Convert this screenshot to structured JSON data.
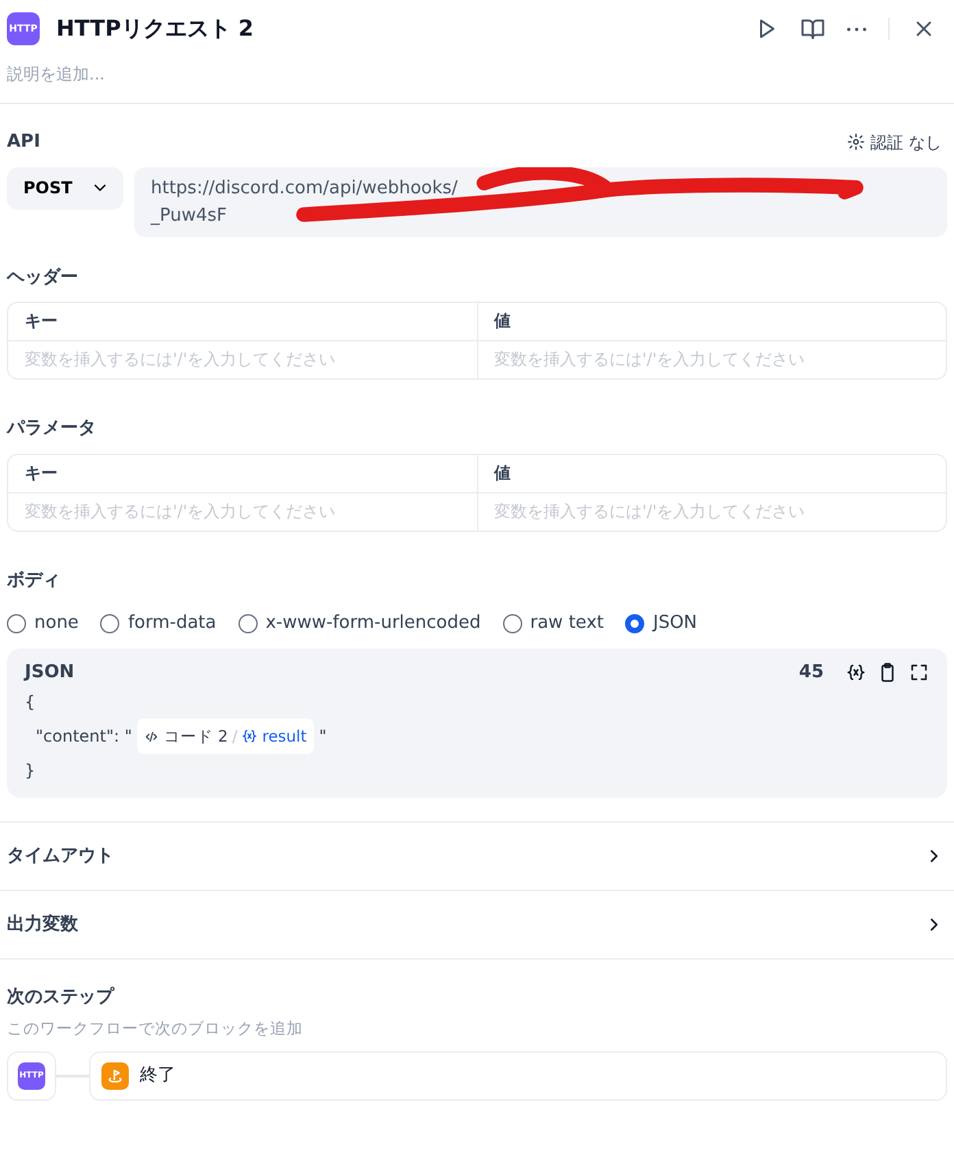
{
  "header": {
    "icon_text": "HTTP",
    "title": "HTTPリクエスト 2",
    "description_placeholder": "説明を追加..."
  },
  "api": {
    "label": "API",
    "auth": "認証 なし",
    "method": "POST",
    "url_lines": [
      "https://discord.com/api/webhooks/",
      "_Puw4sF"
    ]
  },
  "tables": [
    {
      "label": "ヘッダー",
      "columns": [
        "キー",
        "値"
      ],
      "placeholders": [
        "変数を挿入するには'/'を入力してください",
        "変数を挿入するには'/'を入力してください"
      ]
    },
    {
      "label": "パラメータ",
      "columns": [
        "キー",
        "値"
      ],
      "placeholders": [
        "変数を挿入するには'/'を入力してください",
        "変数を挿入するには'/'を入力してください"
      ]
    }
  ],
  "body": {
    "label": "ボディ",
    "options": [
      {
        "label": "none",
        "selected": false
      },
      {
        "label": "form-data",
        "selected": false
      },
      {
        "label": "x-www-form-urlencoded",
        "selected": false
      },
      {
        "label": "raw text",
        "selected": false
      },
      {
        "label": "JSON",
        "selected": true
      }
    ],
    "editor": {
      "label": "JSON",
      "count": "45",
      "open": "{",
      "key": "\"content\": \"",
      "node": "コード 2",
      "sep": "/",
      "variable": "result",
      "quote": "\"",
      "close": "}"
    }
  },
  "sections": [
    {
      "label": "タイムアウト"
    },
    {
      "label": "出力変数"
    }
  ],
  "next_step": {
    "title": "次のステップ",
    "subtitle": "このワークフローで次のブロックを追加",
    "source_icon_text": "HTTP",
    "target": "終了"
  }
}
